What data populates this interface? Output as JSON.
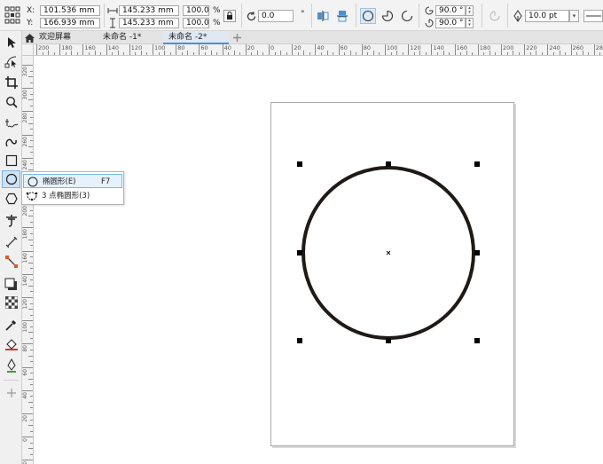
{
  "propbar": {
    "x_label": "X:",
    "x_value": "101.536 mm",
    "y_label": "Y:",
    "y_value": "166.939 mm",
    "width_value": "145.233 mm",
    "height_value": "145.233 mm",
    "scale_w": "100.0",
    "scale_h": "100.0",
    "percent": "%",
    "rotation_value": "0.0",
    "degree_symbol": "°",
    "start_angle": "90.0 °",
    "end_angle": "90.0 °",
    "outline_width": "10.0 pt"
  },
  "tabs": [
    {
      "label": "欢迎屏幕",
      "active": false
    },
    {
      "label": "未命名 -1*",
      "active": false
    },
    {
      "label": "未命名 -2*",
      "active": true
    }
  ],
  "ruler": {
    "h_numbers": [
      "200",
      "180",
      "160",
      "140",
      "120",
      "100",
      "80",
      "60",
      "40",
      "20",
      "0",
      "20",
      "40",
      "60",
      "80",
      "100",
      "120",
      "140",
      "160",
      "180",
      "200",
      "220",
      "240",
      "260",
      "280"
    ],
    "v_numbers": [
      "320",
      "300",
      "280",
      "260",
      "240",
      "220",
      "200",
      "180",
      "160",
      "140",
      "120",
      "100",
      "80",
      "60",
      "40",
      "20",
      "0",
      "20"
    ]
  },
  "flyout": {
    "items": [
      {
        "label": "椭圆形(E)",
        "shortcut": "F7",
        "icon": "ellipse-icon"
      },
      {
        "label": "3 点椭圆形(3)",
        "shortcut": "",
        "icon": "three-point-ellipse-icon"
      }
    ]
  },
  "tools": [
    "pick-tool",
    "shape-tool",
    "crop-tool",
    "zoom-tool",
    "freehand-tool",
    "artistic-media-tool",
    "rectangle-tool",
    "ellipse-tool",
    "polygon-tool",
    "text-tool",
    "parallel-dimension-tool",
    "connector-tool",
    "drop-shadow-tool",
    "transparency-tool",
    "eyedropper-tool",
    "interactive-fill-tool",
    "smart-fill-tool",
    "add-tool"
  ],
  "colors": {
    "accent": "#4a90d9",
    "circle_stroke": "#1f1a17"
  }
}
